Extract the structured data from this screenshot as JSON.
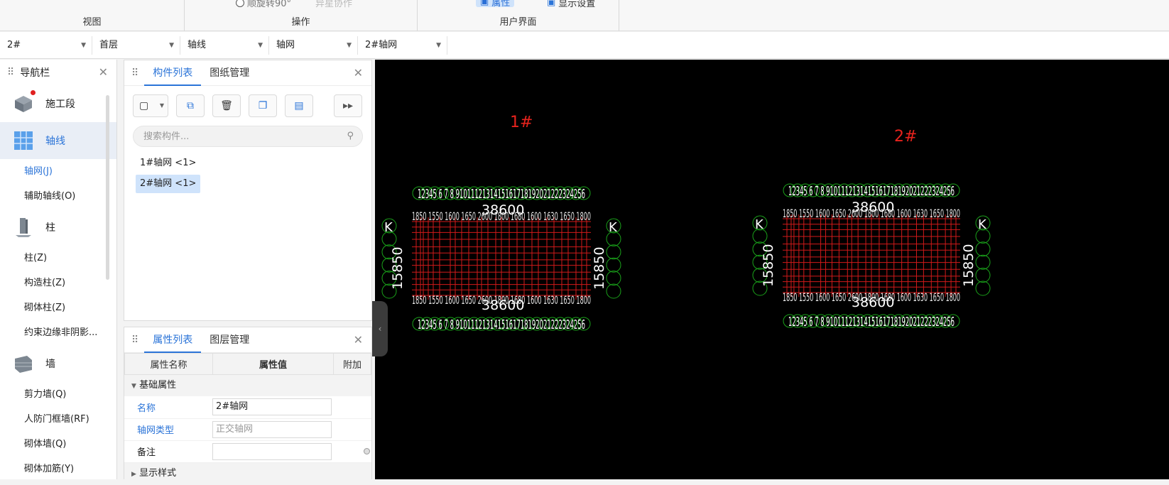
{
  "ribbon": {
    "groups": [
      {
        "label": "视图"
      },
      {
        "label": "操作"
      },
      {
        "label": "用户界面"
      }
    ],
    "items": {
      "rotate90": "顺旋转90°",
      "batch_sync": "异星协作",
      "properties": "属性",
      "display_settings": "显示设置"
    }
  },
  "filterbar": {
    "building": "2#",
    "floor": "首层",
    "category": "轴线",
    "type": "轴网",
    "component": "2#轴网"
  },
  "nav": {
    "title": "导航栏",
    "categories": [
      {
        "label": "施工段",
        "icon": "construction-stage-icon"
      },
      {
        "label": "轴线",
        "icon": "axis-grid-icon",
        "subs": [
          "轴网(J)",
          "辅助轴线(O)"
        ]
      },
      {
        "label": "柱",
        "icon": "column-icon",
        "subs": [
          "柱(Z)",
          "构造柱(Z)",
          "砌体柱(Z)",
          "约束边缘非阴影..."
        ]
      },
      {
        "label": "墙",
        "icon": "wall-icon",
        "subs": [
          "剪力墙(Q)",
          "人防门框墙(RF)",
          "砌体墙(Q)",
          "砌体加筋(Y)"
        ]
      }
    ]
  },
  "components": {
    "tabs": [
      "构件列表",
      "图纸管理"
    ],
    "search_placeholder": "搜索构件...",
    "items": [
      "1#轴网 <1>",
      "2#轴网 <1>"
    ]
  },
  "properties": {
    "tabs": [
      "属性列表",
      "图层管理"
    ],
    "headers": [
      "属性名称",
      "属性值",
      "附加"
    ],
    "group_basic": "基础属性",
    "rows": [
      {
        "name": "名称",
        "value": "2#轴网"
      },
      {
        "name": "轴网类型",
        "value": "正交轴网"
      },
      {
        "name": "备注",
        "value": ""
      }
    ],
    "group_display": "显示样式"
  },
  "canvas": {
    "label_a": "1#",
    "label_b": "2#",
    "dim_a": "38600",
    "dim_b": "15850",
    "axis_nums": "1234 5 6 7 8 9 10 11 12 13 14 15 16 17 18 19 20 21 22 23 24 25 26",
    "axis_row_text_a": "12345 6 7 8 9101112131415161718192021222324256",
    "side_letter": "K",
    "colors": {
      "grid": "#d21a1a",
      "bubble": "#1aa21a",
      "text": "#ffffff",
      "label": "#e8231d"
    }
  }
}
